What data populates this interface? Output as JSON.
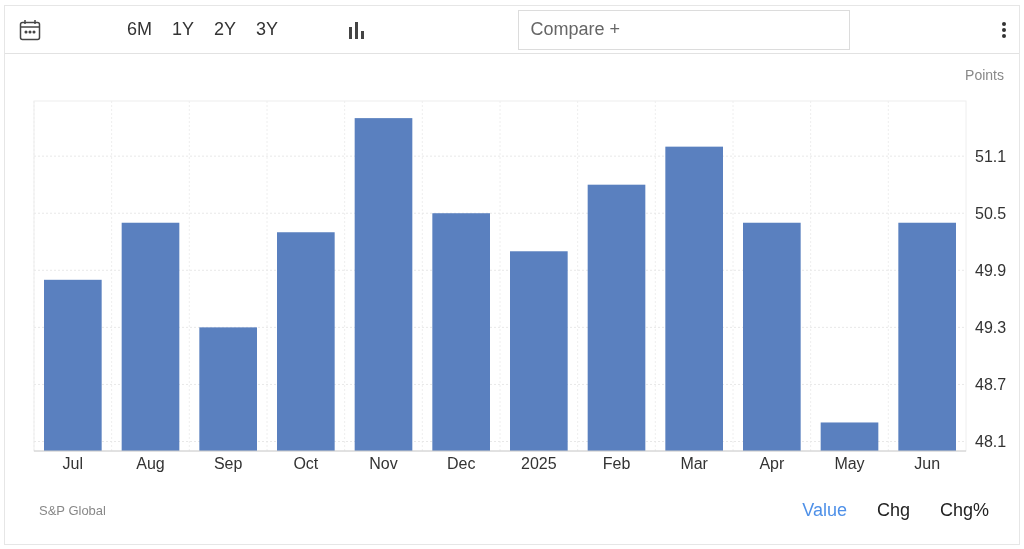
{
  "toolbar": {
    "ranges": [
      "6M",
      "1Y",
      "2Y",
      "3Y"
    ],
    "compare": {
      "placeholder": "Compare +"
    }
  },
  "chart": {
    "source": "S&P Global",
    "chart_data": {
      "type": "bar",
      "grid": true,
      "categories": [
        "Jul",
        "Aug",
        "Sep",
        "Oct",
        "Nov",
        "Dec",
        "2025",
        "Feb",
        "Mar",
        "Apr",
        "May",
        "Jun"
      ],
      "series": [
        {
          "name": "Points",
          "color": "#5a80bf",
          "values": [
            49.8,
            50.4,
            49.3,
            50.3,
            51.5,
            50.5,
            50.1,
            50.8,
            51.2,
            50.4,
            48.3,
            50.4
          ]
        }
      ],
      "ylim": [
        48.0,
        51.68
      ],
      "yticks": [
        48.1,
        48.7,
        49.3,
        49.9,
        50.5,
        51.1
      ]
    }
  },
  "views": [
    {
      "label": "Value",
      "selected": true
    },
    {
      "label": "Chg",
      "selected": false
    },
    {
      "label": "Chg%",
      "selected": false
    }
  ]
}
